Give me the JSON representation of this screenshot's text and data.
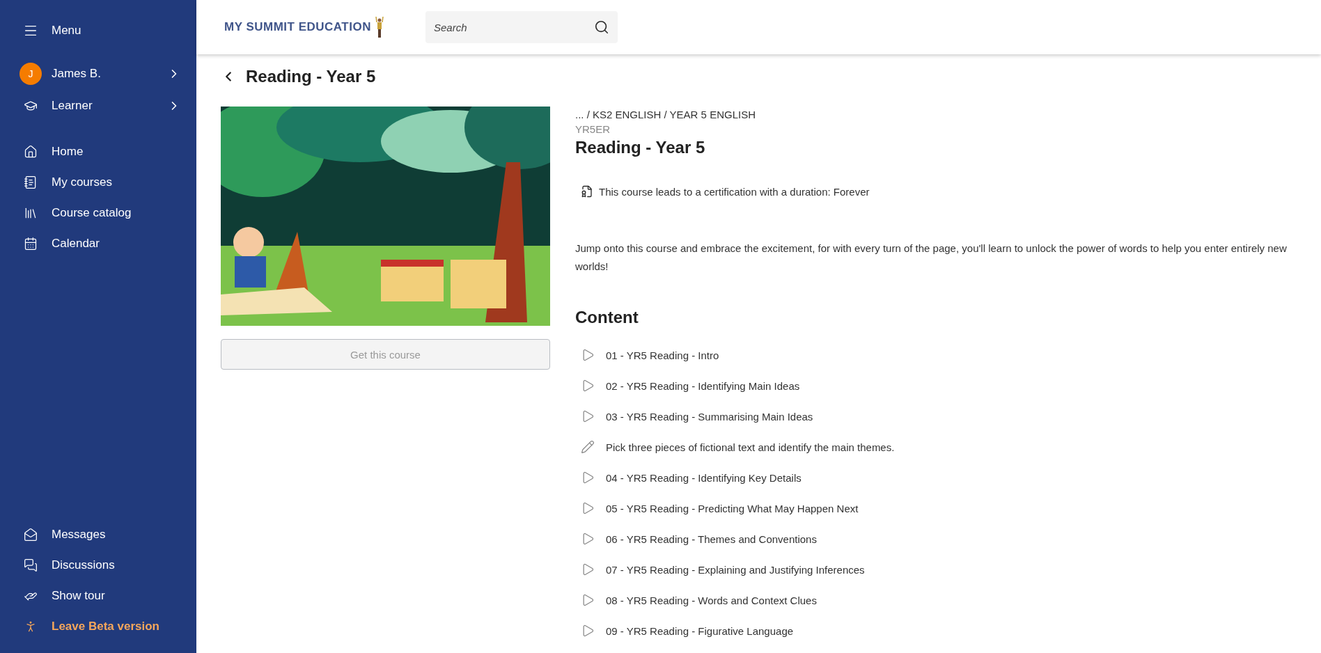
{
  "sidebar": {
    "menu_label": "Menu",
    "user": {
      "initial": "J",
      "name": "James B."
    },
    "role": "Learner",
    "nav": [
      {
        "label": "Home"
      },
      {
        "label": "My courses"
      },
      {
        "label": "Course catalog"
      },
      {
        "label": "Calendar"
      }
    ],
    "bottom": [
      {
        "label": "Messages",
        "kind": "normal"
      },
      {
        "label": "Discussions",
        "kind": "normal"
      },
      {
        "label": "Show tour",
        "kind": "normal"
      },
      {
        "label": "Leave Beta version",
        "kind": "highlight"
      }
    ]
  },
  "header": {
    "logo": "MY SUMMIT EDUCATION",
    "search": {
      "placeholder": "Search"
    }
  },
  "page_title": "Reading - Year 5",
  "course": {
    "button": {
      "label": "Get this course",
      "disabled": true
    },
    "breadcrumb": "... / KS2 ENGLISH / YEAR 5 ENGLISH",
    "code": "YR5ER",
    "title": "Reading - Year 5",
    "certification": "This course leads to a certification with a duration: Forever",
    "description": "Jump onto this course and embrace the excitement, for with every turn of the page, you'll learn to unlock the power of words to help you enter entirely new worlds!"
  },
  "content": {
    "heading": "Content",
    "items": [
      {
        "label": "01 - YR5 Reading - Intro",
        "kind": "video"
      },
      {
        "label": "02 - YR5 Reading - Identifying Main Ideas",
        "kind": "video"
      },
      {
        "label": "03 - YR5 Reading - Summarising Main Ideas",
        "kind": "video"
      },
      {
        "label": "Pick three pieces of fictional text and identify the main themes.",
        "kind": "assignment"
      },
      {
        "label": "04 - YR5 Reading - Identifying Key Details",
        "kind": "video"
      },
      {
        "label": "05 - YR5 Reading - Predicting What May Happen Next",
        "kind": "video"
      },
      {
        "label": "06 - YR5 Reading - Themes and Conventions",
        "kind": "video"
      },
      {
        "label": "07 - YR5 Reading - Explaining and Justifying Inferences",
        "kind": "video"
      },
      {
        "label": "08 - YR5 Reading - Words and Context Clues",
        "kind": "video"
      },
      {
        "label": "09 - YR5 Reading - Figurative Language",
        "kind": "video"
      }
    ]
  }
}
